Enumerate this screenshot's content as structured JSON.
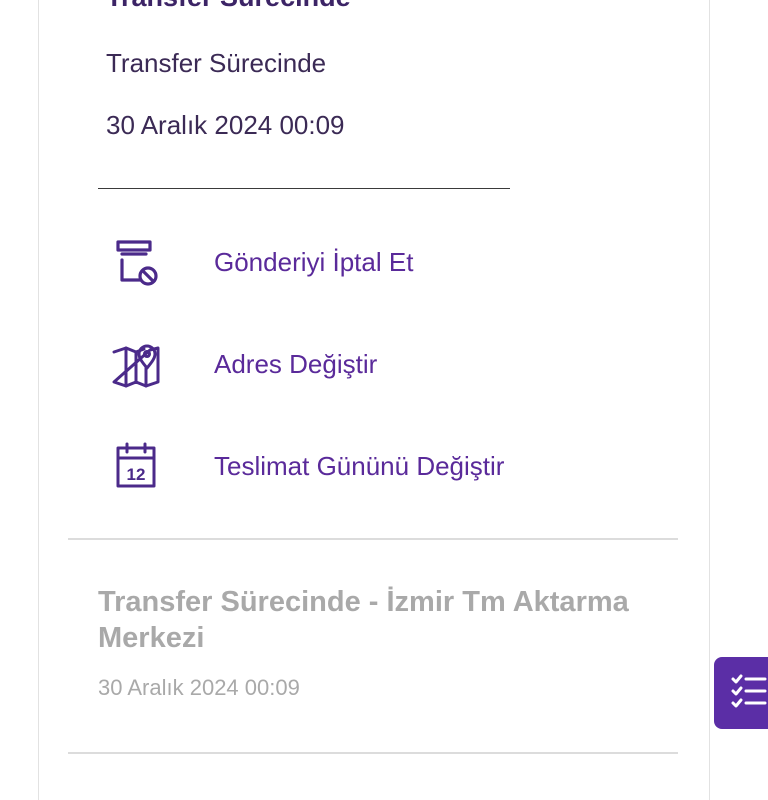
{
  "header": {
    "title": "Transfer Sürecinde",
    "status": "Transfer Sürecinde",
    "date": "30 Aralık 2024 00:09"
  },
  "actions": [
    {
      "icon": "cancel-shipment-icon",
      "label": "Gönderiyi İptal Et"
    },
    {
      "icon": "map-pin-icon",
      "label": "Adres Değiştir"
    },
    {
      "icon": "calendar-icon",
      "label": "Teslimat Gününü Değiştir",
      "calendar_day": "12"
    }
  ],
  "timeline": [
    {
      "title": "Transfer Sürecinde - İzmir Tm Aktarma Merkezi",
      "date": "30 Aralık 2024 00:09"
    }
  ],
  "fab": {
    "icon": "checklist-icon"
  },
  "colors": {
    "accent": "#5b2ea6",
    "title": "#3c2466",
    "muted": "#a9a9a9"
  }
}
